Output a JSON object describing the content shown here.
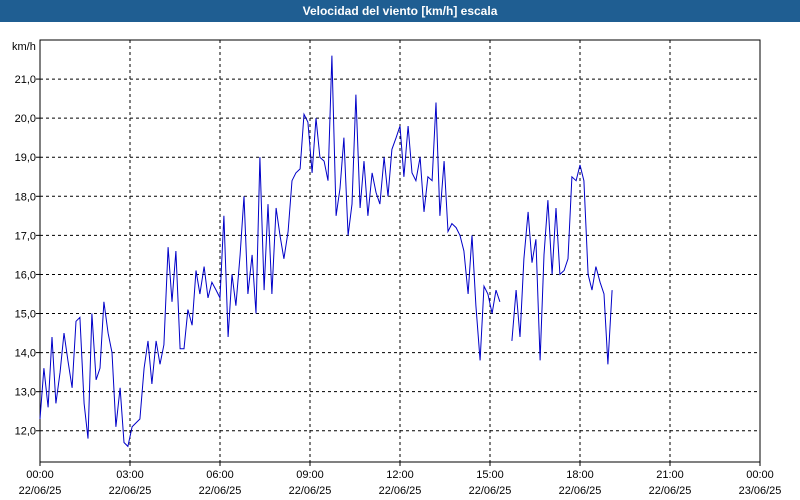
{
  "window": {
    "title": "Velocidad del viento [km/h] escala"
  },
  "chart_data": {
    "type": "line",
    "title": "Velocidad del viento [km/h] escala",
    "ylabel": "km/h",
    "xlabel": "",
    "x_unit": "hours",
    "xlim": [
      0,
      24
    ],
    "ylim": [
      11.2,
      22.0
    ],
    "grid": true,
    "y_ticks": [
      {
        "value": 12.0,
        "label": "12,0"
      },
      {
        "value": 13.0,
        "label": "13,0"
      },
      {
        "value": 14.0,
        "label": "14,0"
      },
      {
        "value": 15.0,
        "label": "15,0"
      },
      {
        "value": 16.0,
        "label": "16,0"
      },
      {
        "value": 17.0,
        "label": "17,0"
      },
      {
        "value": 18.0,
        "label": "18,0"
      },
      {
        "value": 19.0,
        "label": "19,0"
      },
      {
        "value": 20.0,
        "label": "20,0"
      },
      {
        "value": 21.0,
        "label": "21,0"
      }
    ],
    "x_ticks": [
      {
        "value": 0,
        "time": "00:00",
        "date": "22/06/25"
      },
      {
        "value": 3,
        "time": "03:00",
        "date": "22/06/25"
      },
      {
        "value": 6,
        "time": "06:00",
        "date": "22/06/25"
      },
      {
        "value": 9,
        "time": "09:00",
        "date": "22/06/25"
      },
      {
        "value": 12,
        "time": "12:00",
        "date": "22/06/25"
      },
      {
        "value": 15,
        "time": "15:00",
        "date": "22/06/25"
      },
      {
        "value": 18,
        "time": "18:00",
        "date": "22/06/25"
      },
      {
        "value": 21,
        "time": "21:00",
        "date": "22/06/25"
      },
      {
        "value": 24,
        "time": "00:00",
        "date": "23/06/25"
      }
    ],
    "series": [
      {
        "color": "#0000c8",
        "segments": [
          [
            [
              0.0,
              12.3
            ],
            [
              0.13,
              13.6
            ],
            [
              0.27,
              12.6
            ],
            [
              0.4,
              14.4
            ],
            [
              0.53,
              12.7
            ],
            [
              0.67,
              13.5
            ],
            [
              0.8,
              14.5
            ],
            [
              0.93,
              13.8
            ],
            [
              1.07,
              13.1
            ],
            [
              1.2,
              14.8
            ],
            [
              1.33,
              14.9
            ],
            [
              1.47,
              12.7
            ],
            [
              1.6,
              11.8
            ],
            [
              1.73,
              15.0
            ],
            [
              1.87,
              13.3
            ],
            [
              2.0,
              13.6
            ],
            [
              2.13,
              15.3
            ],
            [
              2.27,
              14.5
            ],
            [
              2.4,
              14.0
            ],
            [
              2.53,
              12.1
            ],
            [
              2.67,
              13.1
            ],
            [
              2.8,
              11.7
            ],
            [
              2.93,
              11.6
            ],
            [
              3.07,
              12.1
            ],
            [
              3.2,
              12.2
            ],
            [
              3.33,
              12.3
            ],
            [
              3.47,
              13.6
            ],
            [
              3.6,
              14.3
            ],
            [
              3.73,
              13.2
            ],
            [
              3.87,
              14.3
            ],
            [
              4.0,
              13.7
            ],
            [
              4.13,
              14.2
            ],
            [
              4.27,
              16.7
            ],
            [
              4.4,
              15.3
            ],
            [
              4.53,
              16.6
            ],
            [
              4.67,
              14.1
            ],
            [
              4.8,
              14.1
            ],
            [
              4.93,
              15.1
            ],
            [
              5.07,
              14.7
            ],
            [
              5.2,
              16.1
            ],
            [
              5.33,
              15.5
            ],
            [
              5.47,
              16.2
            ],
            [
              5.6,
              15.4
            ],
            [
              5.73,
              15.8
            ],
            [
              5.87,
              15.6
            ],
            [
              6.0,
              15.4
            ],
            [
              6.13,
              17.5
            ],
            [
              6.27,
              14.4
            ],
            [
              6.4,
              16.0
            ],
            [
              6.53,
              15.2
            ],
            [
              6.67,
              16.5
            ],
            [
              6.8,
              18.0
            ],
            [
              6.93,
              15.5
            ],
            [
              7.07,
              16.5
            ],
            [
              7.2,
              15.0
            ],
            [
              7.33,
              19.0
            ],
            [
              7.47,
              15.6
            ],
            [
              7.6,
              17.8
            ],
            [
              7.73,
              15.5
            ],
            [
              7.87,
              17.7
            ],
            [
              8.0,
              17.0
            ],
            [
              8.13,
              16.4
            ],
            [
              8.27,
              17.1
            ],
            [
              8.4,
              18.4
            ],
            [
              8.53,
              18.6
            ],
            [
              8.67,
              18.7
            ],
            [
              8.8,
              20.1
            ],
            [
              8.93,
              19.9
            ],
            [
              9.07,
              18.6
            ],
            [
              9.2,
              20.0
            ],
            [
              9.33,
              19.0
            ],
            [
              9.47,
              18.9
            ],
            [
              9.6,
              18.4
            ],
            [
              9.73,
              21.6
            ],
            [
              9.87,
              17.5
            ],
            [
              10.0,
              18.2
            ],
            [
              10.13,
              19.5
            ],
            [
              10.27,
              17.0
            ],
            [
              10.4,
              17.8
            ],
            [
              10.53,
              20.6
            ],
            [
              10.67,
              17.7
            ],
            [
              10.8,
              18.9
            ],
            [
              10.93,
              17.5
            ],
            [
              11.07,
              18.6
            ],
            [
              11.2,
              18.1
            ],
            [
              11.33,
              17.8
            ],
            [
              11.47,
              19.0
            ],
            [
              11.6,
              18.0
            ],
            [
              11.73,
              19.2
            ],
            [
              11.87,
              19.5
            ],
            [
              12.0,
              19.8
            ],
            [
              12.13,
              18.5
            ],
            [
              12.27,
              19.8
            ],
            [
              12.4,
              18.6
            ],
            [
              12.53,
              18.4
            ],
            [
              12.67,
              19.0
            ],
            [
              12.8,
              17.6
            ],
            [
              12.93,
              18.5
            ],
            [
              13.07,
              18.4
            ],
            [
              13.2,
              20.4
            ],
            [
              13.33,
              17.5
            ],
            [
              13.47,
              18.9
            ],
            [
              13.6,
              17.1
            ],
            [
              13.73,
              17.3
            ],
            [
              13.87,
              17.2
            ],
            [
              14.0,
              17.0
            ],
            [
              14.13,
              16.6
            ],
            [
              14.27,
              15.5
            ],
            [
              14.4,
              17.0
            ],
            [
              14.53,
              15.2
            ],
            [
              14.67,
              13.8
            ],
            [
              14.8,
              15.7
            ],
            [
              14.93,
              15.5
            ],
            [
              15.07,
              15.0
            ],
            [
              15.2,
              15.6
            ],
            [
              15.33,
              15.3
            ]
          ],
          [
            [
              15.73,
              14.3
            ],
            [
              15.87,
              15.6
            ],
            [
              16.0,
              14.4
            ],
            [
              16.13,
              16.4
            ],
            [
              16.27,
              17.6
            ],
            [
              16.4,
              16.3
            ],
            [
              16.53,
              16.9
            ],
            [
              16.67,
              13.8
            ],
            [
              16.8,
              16.5
            ],
            [
              16.93,
              17.9
            ],
            [
              17.07,
              16.0
            ],
            [
              17.2,
              17.7
            ],
            [
              17.33,
              16.0
            ],
            [
              17.47,
              16.1
            ],
            [
              17.6,
              16.4
            ],
            [
              17.73,
              18.5
            ],
            [
              17.87,
              18.4
            ],
            [
              18.0,
              18.8
            ],
            [
              18.13,
              18.4
            ],
            [
              18.27,
              16.0
            ],
            [
              18.4,
              15.6
            ],
            [
              18.53,
              16.2
            ],
            [
              18.67,
              15.8
            ],
            [
              18.8,
              15.5
            ],
            [
              18.93,
              13.7
            ],
            [
              19.07,
              15.6
            ]
          ]
        ]
      }
    ]
  }
}
